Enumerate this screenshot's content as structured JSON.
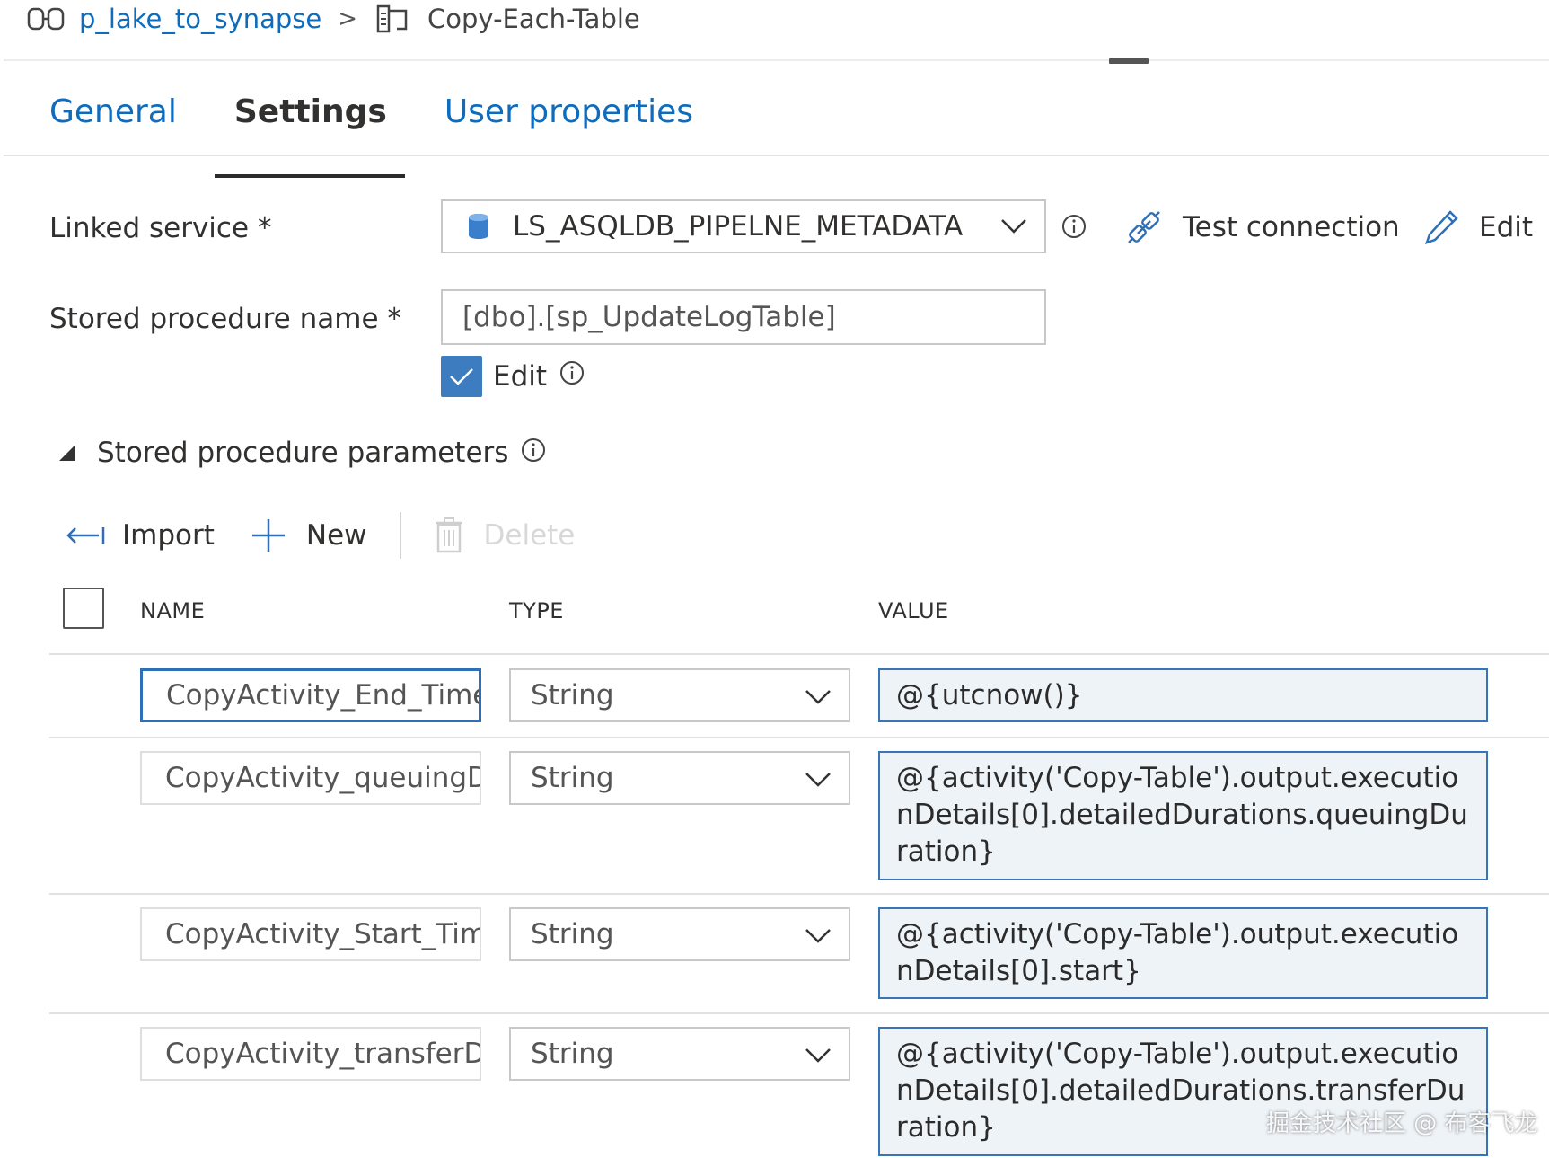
{
  "breadcrumb": {
    "pipeline_name": "p_lake_to_synapse",
    "separator": ">",
    "activity_name": "Copy-Each-Table"
  },
  "tabs": [
    {
      "label": "General",
      "active": false
    },
    {
      "label": "Settings",
      "active": true
    },
    {
      "label": "User properties",
      "active": false
    }
  ],
  "settings": {
    "linked_service_label": "Linked service",
    "linked_service_value": "LS_ASQLDB_PIPELNE_METADATA",
    "required_marker": "*",
    "test_connection_label": "Test connection",
    "edit_label": "Edit",
    "stored_procedure_label": "Stored procedure name",
    "stored_procedure_value": "[dbo].[sp_UpdateLogTable]",
    "edit_checkbox_label": "Edit",
    "edit_checkbox_checked": true
  },
  "params_section": {
    "title": "Stored procedure parameters",
    "toolbar": {
      "import_label": "Import",
      "new_label": "New",
      "delete_label": "Delete"
    },
    "columns": [
      "NAME",
      "TYPE",
      "VALUE"
    ],
    "rows": [
      {
        "name": "CopyActivity_End_Time",
        "type": "String",
        "value": "@{utcnow()}"
      },
      {
        "name": "CopyActivity_queuingDuration",
        "type": "String",
        "value": "@{activity('Copy-Table').output.executionDetails[0].detailedDurations.queuingDuration}"
      },
      {
        "name": "CopyActivity_Start_Time",
        "type": "String",
        "value": "@{activity('Copy-Table').output.executionDetails[0].start}"
      },
      {
        "name": "CopyActivity_transferDuration",
        "type": "String",
        "value": "@{activity('Copy-Table').output.executionDetails[0].detailedDurations.transferDuration}"
      }
    ]
  },
  "watermark": "掘金技术社区 @ 布客飞龙",
  "colors": {
    "link_blue": "#0f6cbd",
    "accent_blue": "#3d7cbf",
    "value_bg": "#eef3f8",
    "text": "#323130"
  }
}
